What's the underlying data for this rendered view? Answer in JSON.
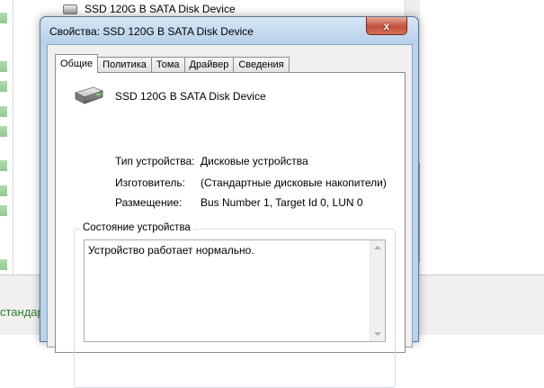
{
  "background": {
    "tree_item_label": "SSD 120G B SATA Disk Device",
    "status_text": "стандар"
  },
  "dialog": {
    "title": "Свойства: SSD 120G B SATA Disk Device",
    "close_label": "x",
    "tabs": [
      {
        "label": "Общие",
        "active": true
      },
      {
        "label": "Политика",
        "active": false
      },
      {
        "label": "Тома",
        "active": false
      },
      {
        "label": "Драйвер",
        "active": false
      },
      {
        "label": "Сведения",
        "active": false
      }
    ],
    "device_name": "SSD 120G B SATA Disk Device",
    "device_icon": "hard-drive-icon",
    "properties": [
      {
        "label": "Тип устройства:",
        "value": "Дисковые устройства"
      },
      {
        "label": "Изготовитель:",
        "value": "(Стандартные дисковые накопители)"
      },
      {
        "label": "Размещение:",
        "value": "Bus Number 1, Target Id 0, LUN 0"
      }
    ],
    "status_group_title": "Состояние устройства",
    "status_text": "Устройство работает нормально."
  },
  "colors": {
    "titlebar": "#b7cfe8",
    "close_button": "#c4513b",
    "status_green": "#2f7d2f"
  }
}
